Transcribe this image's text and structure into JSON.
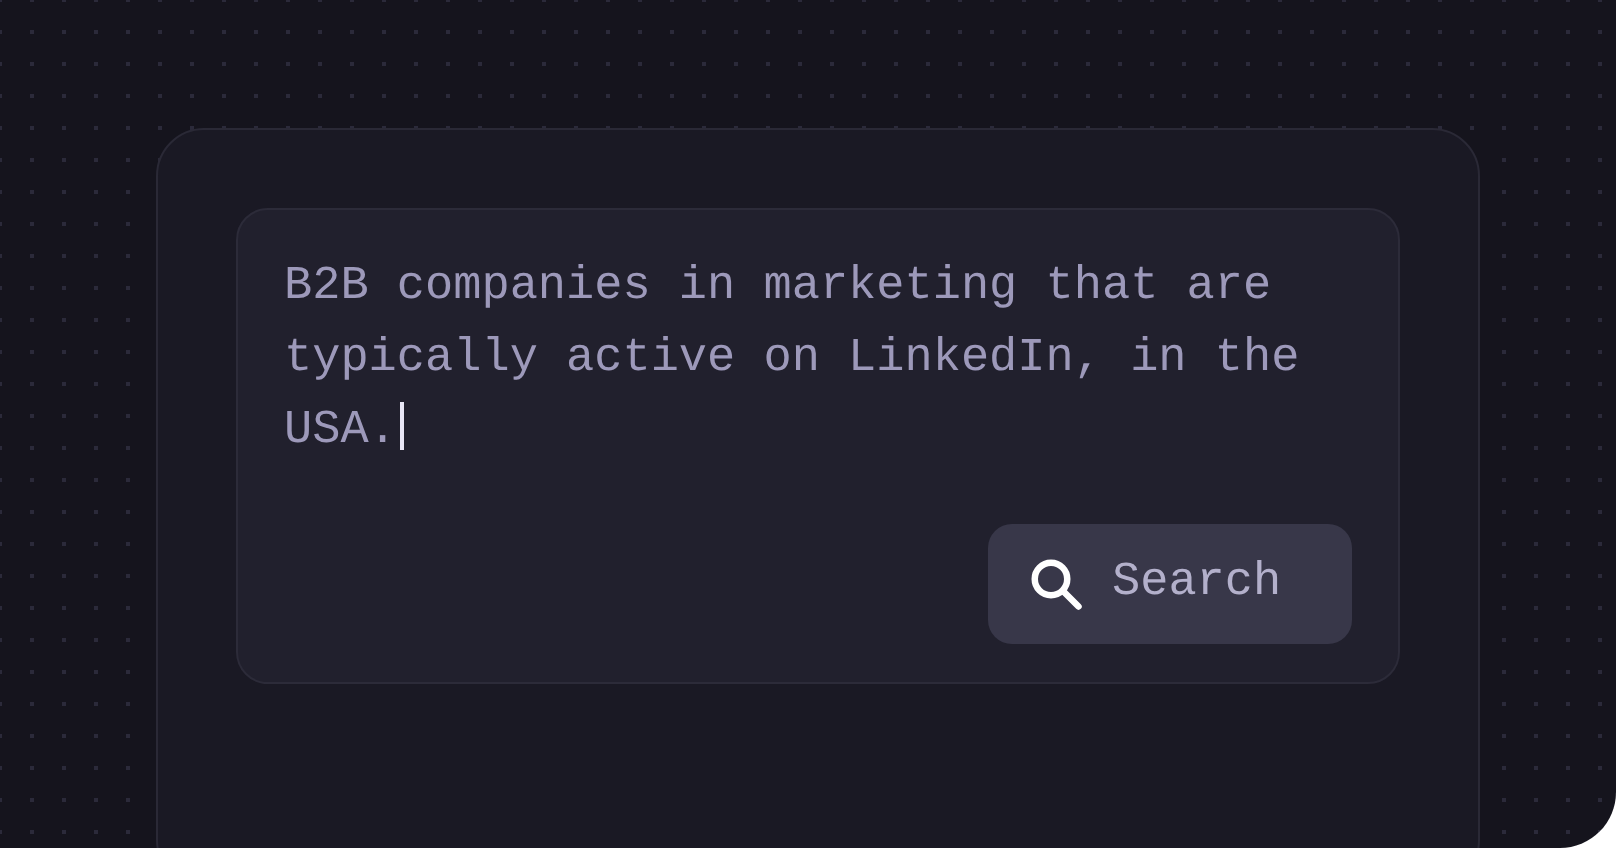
{
  "query": {
    "value": "B2B companies in marketing that are typically active on LinkedIn, in the USA.",
    "focused": true
  },
  "search_button": {
    "label": "Search"
  }
}
